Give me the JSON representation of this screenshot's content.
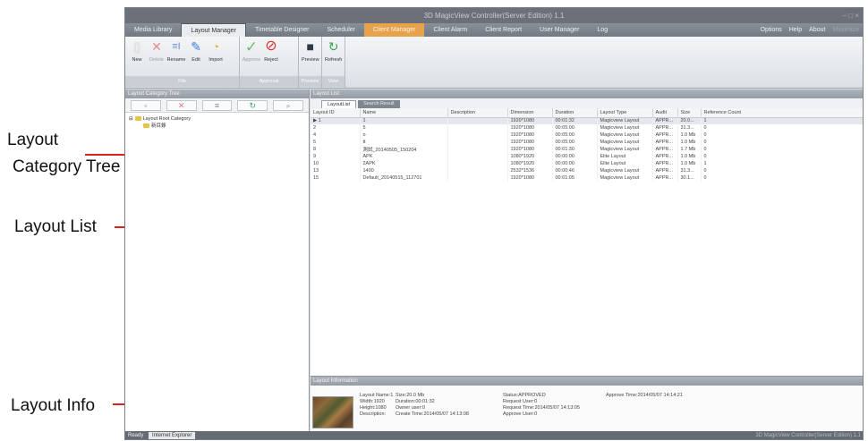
{
  "callouts": {
    "category_tree_line1": "Layout",
    "category_tree_line2": "Category Tree",
    "layout_list": "Layout List",
    "layout_info": "Layout Info"
  },
  "accent_colors": {
    "arrow": "#e0201c",
    "highlight_tab": "#e6a24d"
  },
  "app": {
    "title": "3D MagicView Controller(Server Edition) 1.1",
    "window_buttons": "– □ ×",
    "menu": {
      "tabs": [
        "Media Library",
        "Layout Manager",
        "Timetable Designer",
        "Scheduler",
        "Client Manager",
        "Client Alarm",
        "Client Report",
        "User Manager",
        "Log"
      ],
      "right": [
        "Options",
        "Help",
        "About",
        "Maximize"
      ]
    },
    "ribbon": {
      "file_group": {
        "name": "File",
        "buttons": [
          {
            "label": "New",
            "icon": "new-document-icon"
          },
          {
            "label": "Delete",
            "icon": "delete-x-icon"
          },
          {
            "label": "Rename",
            "icon": "rename-icon"
          },
          {
            "label": "Edit",
            "icon": "edit-pencil-icon"
          },
          {
            "label": "Import",
            "icon": "import-icon"
          }
        ]
      },
      "approval_group": {
        "name": "Approval",
        "buttons": [
          {
            "label": "Approve",
            "icon": "checkmark-icon"
          },
          {
            "label": "Reject",
            "icon": "reject-circle-icon"
          }
        ]
      },
      "preview_group": {
        "name": "Preview",
        "buttons": [
          {
            "label": "Preview",
            "icon": "preview-icon"
          }
        ]
      },
      "view_group": {
        "name": "View",
        "buttons": [
          {
            "label": "Refresh",
            "icon": "refresh-icon"
          }
        ]
      }
    },
    "left_panel": {
      "title": "Layout Category Tree",
      "tools": [
        "new-category-icon",
        "delete-category-icon",
        "rename-category-icon",
        "refresh-category-icon",
        "search-category-icon"
      ],
      "tree": {
        "root": "Layout Root Category",
        "child": "新目錄"
      }
    },
    "right_panel": {
      "title": "Layout List",
      "tabs": [
        "LayoutList",
        "Search Result"
      ],
      "columns": [
        "Layout ID",
        "Name",
        "Description",
        "Dimension",
        "Duration",
        "Layout Type",
        "Audit",
        "Size",
        "Reference Count"
      ],
      "rows": [
        [
          "1",
          "1",
          "",
          "1920*1080",
          "00:01:32",
          "Magicview Layout",
          "APPR...",
          "20.0...",
          "1"
        ],
        [
          "2",
          "5",
          "",
          "1920*1080",
          "00:05:00",
          "Magicview Layout",
          "APPR...",
          "31.3...",
          "0"
        ],
        [
          "4",
          "o",
          "",
          "1920*1080",
          "00:05:00",
          "Magicview Layout",
          "APPR...",
          "1.0 Mb",
          "0"
        ],
        [
          "5",
          "tt",
          "",
          "1920*1080",
          "00:05:00",
          "Magicview Layout",
          "APPR...",
          "1.0 Mb",
          "0"
        ],
        [
          "8",
          "測試_20140505_150204",
          "",
          "1920*1080",
          "00:01:30",
          "Magicview Layout",
          "APPR...",
          "1.7 Mb",
          "0"
        ],
        [
          "9",
          "APK",
          "",
          "1080*1920",
          "00:00:00",
          "Elite Layout",
          "APPR...",
          "1.0 Mb",
          "0"
        ],
        [
          "10",
          "2APK",
          "",
          "1080*1920",
          "00:00:00",
          "Elite Layout",
          "APPR...",
          "1.0 Mb",
          "1"
        ],
        [
          "13",
          "1400",
          "",
          "2532*1536",
          "00:00:46",
          "Magicview Layout",
          "APPR...",
          "31.3...",
          "0"
        ],
        [
          "15",
          "Default_20140515_112701",
          "",
          "1920*1080",
          "00:01:05",
          "Magicview Layout",
          "APPR...",
          "30.1...",
          "0"
        ]
      ]
    },
    "info_panel": {
      "title": "Layout Information",
      "col1": [
        "Layout Name:1",
        "Width:1920",
        "Height:1080",
        "Description:"
      ],
      "col2": [
        "Size:20.0 Mb",
        "Duration:00:01:32",
        "Owner user:0",
        "Create Time:2014/05/07 14:13:08"
      ],
      "col3": [
        "Status:APPROVED",
        "Request User:0",
        "Request Time:2014/05/07 14:13:05",
        "Approve User:0"
      ],
      "col4": [
        "Approve Time:2014/05/07 14:14:21"
      ]
    },
    "status": {
      "ready": "Ready",
      "ie_tab": "Internet Explorer",
      "right": "3D MagicView Controller(Server Edition) 1.1"
    }
  }
}
